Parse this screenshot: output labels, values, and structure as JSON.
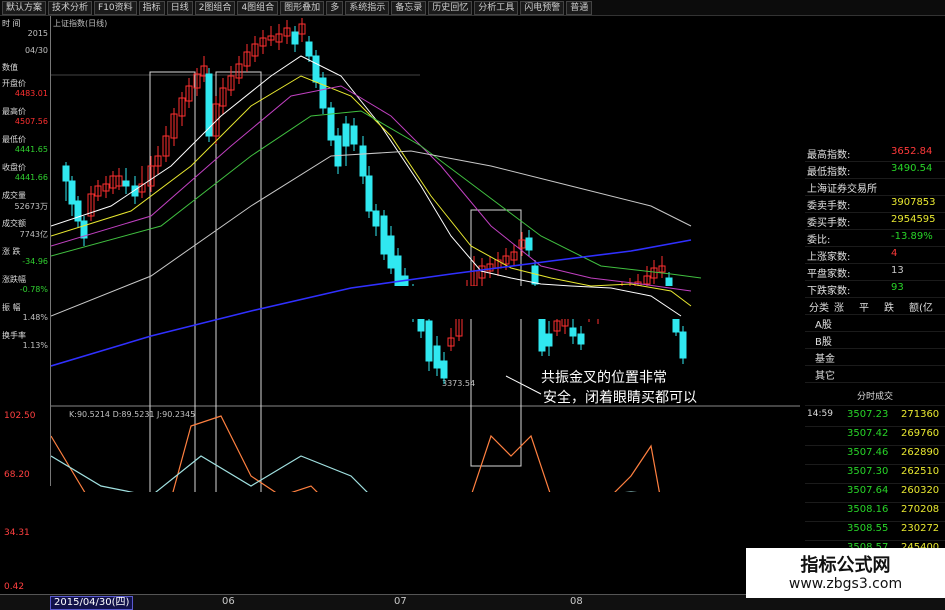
{
  "toolbar": {
    "items": [
      "默认方案",
      "技术分析",
      "F10资料",
      "指标",
      "日线",
      "2图组合",
      "4图组合",
      "图形叠加",
      "多",
      "系统指示",
      "备忘录",
      "历史回忆",
      "分析工具",
      "闪电预警",
      "普通"
    ]
  },
  "chart_title": "上证指数(日线)",
  "indicator_label": "K:90.5214  D:89.5231  J:90.2345",
  "left_panel": {
    "rows": [
      {
        "label": "时 间",
        "value": "2015"
      },
      {
        "label": "",
        "value": "04/30"
      },
      {
        "label": "数值",
        "value": ""
      },
      {
        "label": "开盘价",
        "value": "4483.01",
        "cls": "lp-red"
      },
      {
        "label": "最高价",
        "value": "4507.56",
        "cls": "lp-red"
      },
      {
        "label": "最低价",
        "value": "4441.65",
        "cls": "lp-grn"
      },
      {
        "label": "收盘价",
        "value": "4441.66",
        "cls": "lp-grn"
      },
      {
        "label": "成交量",
        "value": "52673万"
      },
      {
        "label": "成交额",
        "value": "7743亿"
      },
      {
        "label": "涨 跌",
        "value": "-34.96",
        "cls": "lp-grn"
      },
      {
        "label": "涨跌幅",
        "value": "-0.78%",
        "cls": "lp-grn"
      },
      {
        "label": "振 幅",
        "value": "1.48%"
      },
      {
        "label": "换手率",
        "value": "1.13%"
      }
    ]
  },
  "low_label": "3373.54",
  "annotation": {
    "line1": "共振金叉的位置非常",
    "line2": "安全，闭着眼睛买都可以"
  },
  "y_ticks": [
    "102.50",
    "68.20",
    "34.31",
    "0.42"
  ],
  "bottom": {
    "date": "2015/04/30(四)",
    "months": [
      "06",
      "07",
      "08"
    ]
  },
  "right_panel": {
    "stats": [
      {
        "label": "最高指数:",
        "value": "3652.84",
        "cls": "col-red"
      },
      {
        "label": "最低指数:",
        "value": "3490.54",
        "cls": "col-grn"
      },
      {
        "label": "上海证券交易所",
        "value": "",
        "cls": ""
      },
      {
        "label": "委卖手数:",
        "value": "3907853",
        "cls": "col-yel"
      },
      {
        "label": "委买手数:",
        "value": "2954595",
        "cls": "col-yel"
      },
      {
        "label": "委比:",
        "value": "-13.89%",
        "cls": "col-grn"
      },
      {
        "label": "上涨家数:",
        "value": "4",
        "cls": "col-red"
      },
      {
        "label": "平盘家数:",
        "value": "13",
        "cls": ""
      },
      {
        "label": "下跌家数:",
        "value": "93",
        "cls": "col-grn"
      }
    ],
    "table_head": [
      "分类",
      "涨",
      "平",
      "跌",
      "额(亿"
    ],
    "table_rows": [
      "A股",
      "B股",
      "基金",
      "其它"
    ],
    "ticks_header": "分时成交",
    "ticks": [
      {
        "time": "14:59",
        "price": "3507.23",
        "vol": "271360"
      },
      {
        "time": "",
        "price": "3507.42",
        "vol": "269760"
      },
      {
        "time": "",
        "price": "3507.46",
        "vol": "262890"
      },
      {
        "time": "",
        "price": "3507.30",
        "vol": "262510"
      },
      {
        "time": "",
        "price": "3507.64",
        "vol": "260320"
      },
      {
        "time": "",
        "price": "3508.16",
        "vol": "270208"
      },
      {
        "time": "",
        "price": "3508.55",
        "vol": "230272"
      },
      {
        "time": "",
        "price": "3508.57",
        "vol": "245400"
      }
    ]
  },
  "watermark": {
    "title": "指标公式网",
    "url": "www.zbgs3.com"
  },
  "colors": {
    "up": "#ff3030",
    "down": "#30e8f0",
    "ma5": "#ffffff",
    "ma10": "#e8e830",
    "ma20": "#c040c0",
    "ma30": "#40c040",
    "ma60": "#c8c8c8",
    "ma120": "#3030ff",
    "k": "#ff8040",
    "d": "#a0e0e0"
  }
}
